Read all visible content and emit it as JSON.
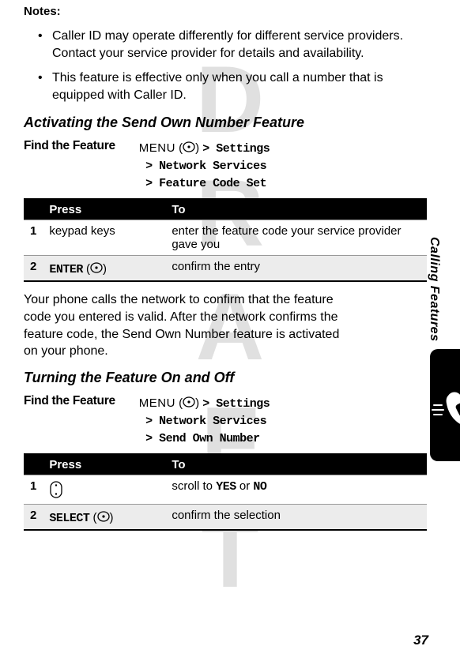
{
  "watermark": "DRAFT",
  "notes_label": "Notes:",
  "bullets": [
    "Caller ID may operate differently for different service providers. Contact your service provider for details and availability.",
    "This feature is effective only when you call a number that is equipped with Caller ID."
  ],
  "section1": {
    "heading": "Activating the Send Own Number Feature",
    "find_label": "Find the Feature",
    "menu_word": "MENU",
    "path_lines": [
      "> Settings",
      "> Network Services",
      "> Feature Code Set"
    ],
    "table": {
      "headers": [
        "Press",
        "To"
      ],
      "rows": [
        {
          "num": "1",
          "press": "keypad keys",
          "to": "enter the feature code your service provider gave you",
          "shaded": false,
          "key_icon": false,
          "enter_style": false
        },
        {
          "num": "2",
          "press": "ENTER",
          "to": "confirm the entry",
          "shaded": true,
          "key_icon": true,
          "enter_style": true
        }
      ]
    }
  },
  "mid_para": "Your phone calls the network to confirm that the feature code you entered is valid. After the network confirms the feature code, the Send Own Number feature is activated on your phone.",
  "section2": {
    "heading": "Turning the Feature On and Off",
    "find_label": "Find the Feature",
    "menu_word": "MENU",
    "path_lines": [
      "> Settings",
      "> Network Services",
      "> Send Own Number"
    ],
    "table": {
      "headers": [
        "Press",
        "To"
      ],
      "rows": [
        {
          "num": "1",
          "press_icon": "nav",
          "to_pre": "scroll to ",
          "to_opt1": "YES",
          "to_mid": " or ",
          "to_opt2": "NO",
          "shaded": false
        },
        {
          "num": "2",
          "press": "SELECT",
          "to": "confirm the selection",
          "shaded": true,
          "key_icon": true
        }
      ]
    }
  },
  "side_label": "Calling Features",
  "page_number": "37"
}
